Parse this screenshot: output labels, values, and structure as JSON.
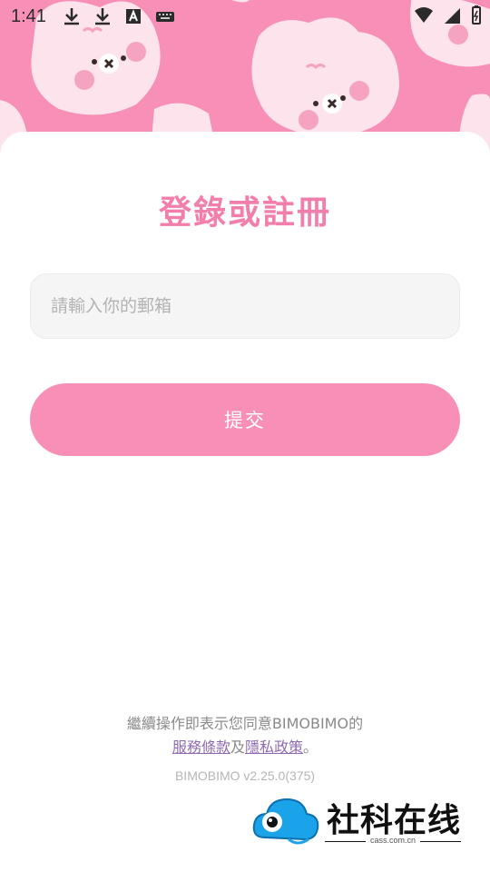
{
  "status_bar": {
    "time": "1:41"
  },
  "login": {
    "title": "登錄或註冊",
    "email_placeholder": "請輸入你的郵箱",
    "submit_label": "提交"
  },
  "footer": {
    "agreement_text": "繼續操作即表示您同意BIMOBIMO的",
    "terms_link": "服務條款",
    "conjunction": "及",
    "privacy_link": "隱私政策",
    "period": "。",
    "version": "BIMOBIMO v2.25.0(375)"
  },
  "watermark": {
    "name": "社科在线",
    "url": "cass.com.cn"
  },
  "colors": {
    "brand_pink": "#f78fb6",
    "title_pink": "#f27fab",
    "link_purple": "#8e6bb0"
  }
}
